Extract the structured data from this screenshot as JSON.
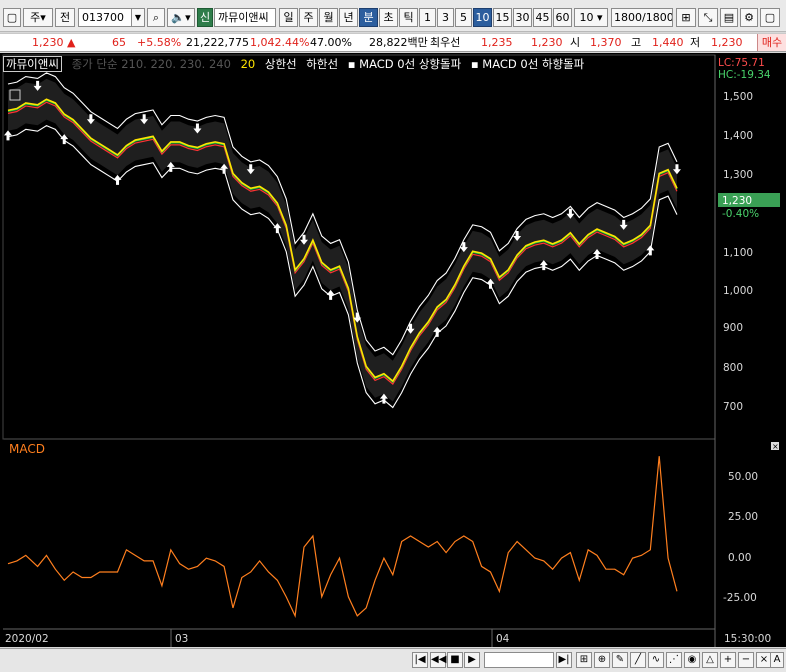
{
  "toolbar": {
    "market_select": "주",
    "view_label": "전",
    "stock_code": "013700",
    "sin_badge": "신",
    "stock_name": "까뮤이앤씨",
    "periods": [
      "일",
      "주",
      "월",
      "년",
      "분",
      "초",
      "틱"
    ],
    "active_period": "분",
    "intervals": [
      "1",
      "3",
      "5",
      "10",
      "15",
      "30",
      "45",
      "60"
    ],
    "active_interval": "10",
    "interval_select": "10",
    "count_value": "1800",
    "count_total": "/1800"
  },
  "quote": {
    "price": "1,230",
    "change": "65",
    "change_pct": "+5.58%",
    "volume": "21,222,775",
    "volume_ratio": "1,042.44%",
    "turnover_pct": "47.00%",
    "amount": "28,822백만",
    "lowest_label": "최우선",
    "ask": "1,235",
    "bid": "1,230",
    "open_label": "시",
    "open": "1,370",
    "high_label": "고",
    "high": "1,440",
    "low_label": "저",
    "low": "1,230",
    "trade_button": "매수"
  },
  "legend": {
    "name": "까뮤이앤씨",
    "ma_label": "종가 단순 210. 220. 230. 240",
    "ma_20": "20",
    "upper_limit": "상한선",
    "lower_limit": "하한선",
    "macd_up": "MACD 0선 상향돌파",
    "macd_down": "MACD 0선 하향돌파"
  },
  "price_pane": {
    "lc": "LC:75.71",
    "hc": "HC:-19.34",
    "current_tag": "1,230",
    "current_pct": "-0.40%",
    "y_ticks": [
      "1,500",
      "1,400",
      "1,300",
      "1,200",
      "1,100",
      "1,000",
      "900",
      "800",
      "700"
    ]
  },
  "macd_pane": {
    "title": "MACD",
    "y_ticks": [
      "50.00",
      "25.00",
      "0.00",
      "-25.00"
    ]
  },
  "x_axis": {
    "labels": [
      "2020/02",
      "03",
      "04"
    ],
    "time": "15:30:00"
  },
  "colors": {
    "accent": "#2c5e9e",
    "price_up": "#e0211b",
    "macd_line": "#ff7f1e",
    "ma_yellow": "#ffe400",
    "ma_green": "#1cc540",
    "band_line": "#ffffff",
    "current_tag_bg": "#3aa055"
  },
  "chart_data": {
    "type": "line",
    "price_series": [
      [
        0,
        1470
      ],
      [
        0.015,
        1475
      ],
      [
        0.03,
        1490
      ],
      [
        0.05,
        1485
      ],
      [
        0.065,
        1500
      ],
      [
        0.08,
        1490
      ],
      [
        0.095,
        1460
      ],
      [
        0.11,
        1445
      ],
      [
        0.125,
        1420
      ],
      [
        0.14,
        1395
      ],
      [
        0.155,
        1380
      ],
      [
        0.17,
        1365
      ],
      [
        0.185,
        1350
      ],
      [
        0.2,
        1375
      ],
      [
        0.215,
        1390
      ],
      [
        0.23,
        1395
      ],
      [
        0.245,
        1400
      ],
      [
        0.26,
        1360
      ],
      [
        0.275,
        1385
      ],
      [
        0.29,
        1385
      ],
      [
        0.305,
        1375
      ],
      [
        0.32,
        1370
      ],
      [
        0.335,
        1380
      ],
      [
        0.35,
        1385
      ],
      [
        0.365,
        1380
      ],
      [
        0.38,
        1300
      ],
      [
        0.395,
        1275
      ],
      [
        0.41,
        1260
      ],
      [
        0.425,
        1265
      ],
      [
        0.44,
        1250
      ],
      [
        0.455,
        1220
      ],
      [
        0.47,
        1160
      ],
      [
        0.485,
        1040
      ],
      [
        0.5,
        1070
      ],
      [
        0.515,
        1120
      ],
      [
        0.53,
        1060
      ],
      [
        0.545,
        1040
      ],
      [
        0.56,
        1050
      ],
      [
        0.575,
        990
      ],
      [
        0.59,
        860
      ],
      [
        0.605,
        780
      ],
      [
        0.62,
        750
      ],
      [
        0.635,
        760
      ],
      [
        0.65,
        740
      ],
      [
        0.665,
        780
      ],
      [
        0.68,
        830
      ],
      [
        0.695,
        870
      ],
      [
        0.71,
        900
      ],
      [
        0.725,
        940
      ],
      [
        0.74,
        960
      ],
      [
        0.755,
        1000
      ],
      [
        0.77,
        1050
      ],
      [
        0.785,
        1090
      ],
      [
        0.8,
        1085
      ],
      [
        0.815,
        1070
      ],
      [
        0.83,
        1020
      ],
      [
        0.845,
        1040
      ],
      [
        0.86,
        1080
      ],
      [
        0.875,
        1105
      ],
      [
        0.89,
        1115
      ],
      [
        0.905,
        1120
      ],
      [
        0.92,
        1110
      ],
      [
        0.935,
        1120
      ],
      [
        0.95,
        1140
      ],
      [
        0.965,
        1110
      ],
      [
        0.98,
        1135
      ],
      [
        0.995,
        1150
      ],
      [
        1.01,
        1140
      ],
      [
        1.025,
        1130
      ],
      [
        1.04,
        1110
      ],
      [
        1.055,
        1120
      ],
      [
        1.07,
        1135
      ],
      [
        1.085,
        1160
      ],
      [
        1.1,
        1300
      ],
      [
        1.115,
        1310
      ],
      [
        1.13,
        1260
      ]
    ],
    "price_ylim": [
      600,
      1560
    ],
    "macd_ylim": [
      -35,
      70
    ],
    "series": [
      {
        "name": "MACD",
        "color": "#ff7f1e"
      }
    ]
  }
}
